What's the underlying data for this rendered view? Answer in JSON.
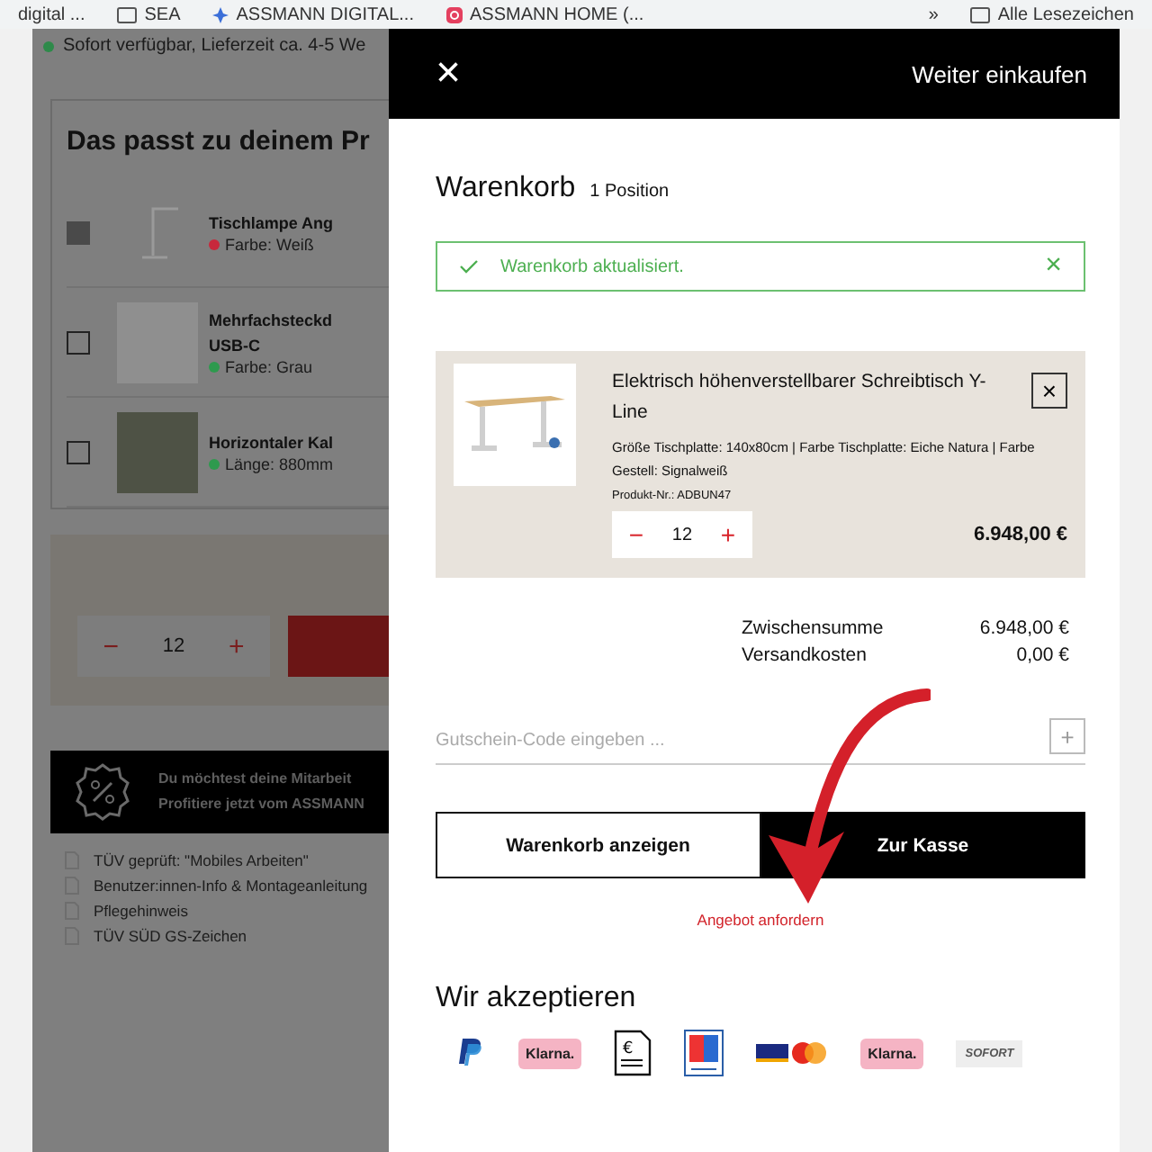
{
  "bookmarks_bar": {
    "items": [
      {
        "kind": "text",
        "label": "digital ..."
      },
      {
        "kind": "folder",
        "label": "SEA"
      },
      {
        "kind": "app",
        "label": "ASSMANN DIGITAL..."
      },
      {
        "kind": "instagram",
        "label": "ASSMANN HOME (..."
      },
      {
        "kind": "overflow",
        "label": "»"
      },
      {
        "kind": "folder",
        "label": "Alle Lesezeichen"
      }
    ]
  },
  "background_page": {
    "availability": "Sofort verfügbar, Lieferzeit ca. 4-5 We",
    "recommendations": {
      "title": "Das passt zu deinem Pr",
      "items": [
        {
          "name": "Tischlampe Ang",
          "attribute": "Farbe: Weiß",
          "checked": true,
          "color": "#c8283c",
          "kind": "lamp"
        },
        {
          "name": "Mehrfachsteckd USB-C",
          "attribute": "Farbe: Grau",
          "checked": false,
          "color": "#2e9a4e",
          "kind": "plug"
        },
        {
          "name": "Horizontaler Kal",
          "attribute": "Länge: 880mm",
          "checked": false,
          "color": "#2e9a4e",
          "kind": "photo"
        }
      ]
    },
    "quantity": {
      "minus": "−",
      "value": "12",
      "plus": "+"
    },
    "promo": {
      "lines": [
        "Du möchtest deine Mitarbeit",
        "Profitiere jetzt vom ASSMANN"
      ]
    },
    "documents": [
      "TÜV geprüft: \"Mobiles Arbeiten\"",
      "Benutzer:innen-Info & Montageanleitung",
      "Pflegehinweis",
      "TÜV SÜD GS-Zeichen"
    ]
  },
  "cart_drawer": {
    "close": "×",
    "continue_shopping": "Weiter einkaufen",
    "title": "Warenkorb",
    "count": "1 Position",
    "notice": {
      "text": "Warenkorb aktualisiert.",
      "close": "×"
    },
    "items": [
      {
        "name": "Elektrisch höhenverstellbarer Schreibtisch Y-Line",
        "details": "Größe Tischplatte: 140x80cm | Farbe Tischplatte: Eiche Natura | Farbe Gestell: Signalweiß",
        "product_no": "Produkt-Nr.: ADBUN47",
        "quantity": "12",
        "minus": "−",
        "plus": "+",
        "price": "6.948,00 €",
        "remove": "×"
      }
    ],
    "totals": [
      {
        "label": "Zwischensumme",
        "value": "6.948,00 €"
      },
      {
        "label": "Versandkosten",
        "value": "0,00 €"
      }
    ],
    "coupon": {
      "placeholder": "Gutschein-Code eingeben ...",
      "add": "+"
    },
    "buttons": [
      {
        "label": "Warenkorb anzeigen",
        "kind": "secondary"
      },
      {
        "label": "Zur Kasse",
        "kind": "primary"
      }
    ],
    "quote_link": "Angebot anfordern",
    "payment": {
      "title": "Wir akzeptieren",
      "methods": [
        {
          "kind": "paypal"
        },
        {
          "kind": "klarna",
          "label": "Klarna."
        },
        {
          "kind": "invoice",
          "label": "€"
        },
        {
          "kind": "ec"
        },
        {
          "kind": "cards"
        },
        {
          "kind": "klarna",
          "label": "Klarna."
        },
        {
          "kind": "sofort",
          "label": "SOFORT"
        }
      ]
    }
  }
}
